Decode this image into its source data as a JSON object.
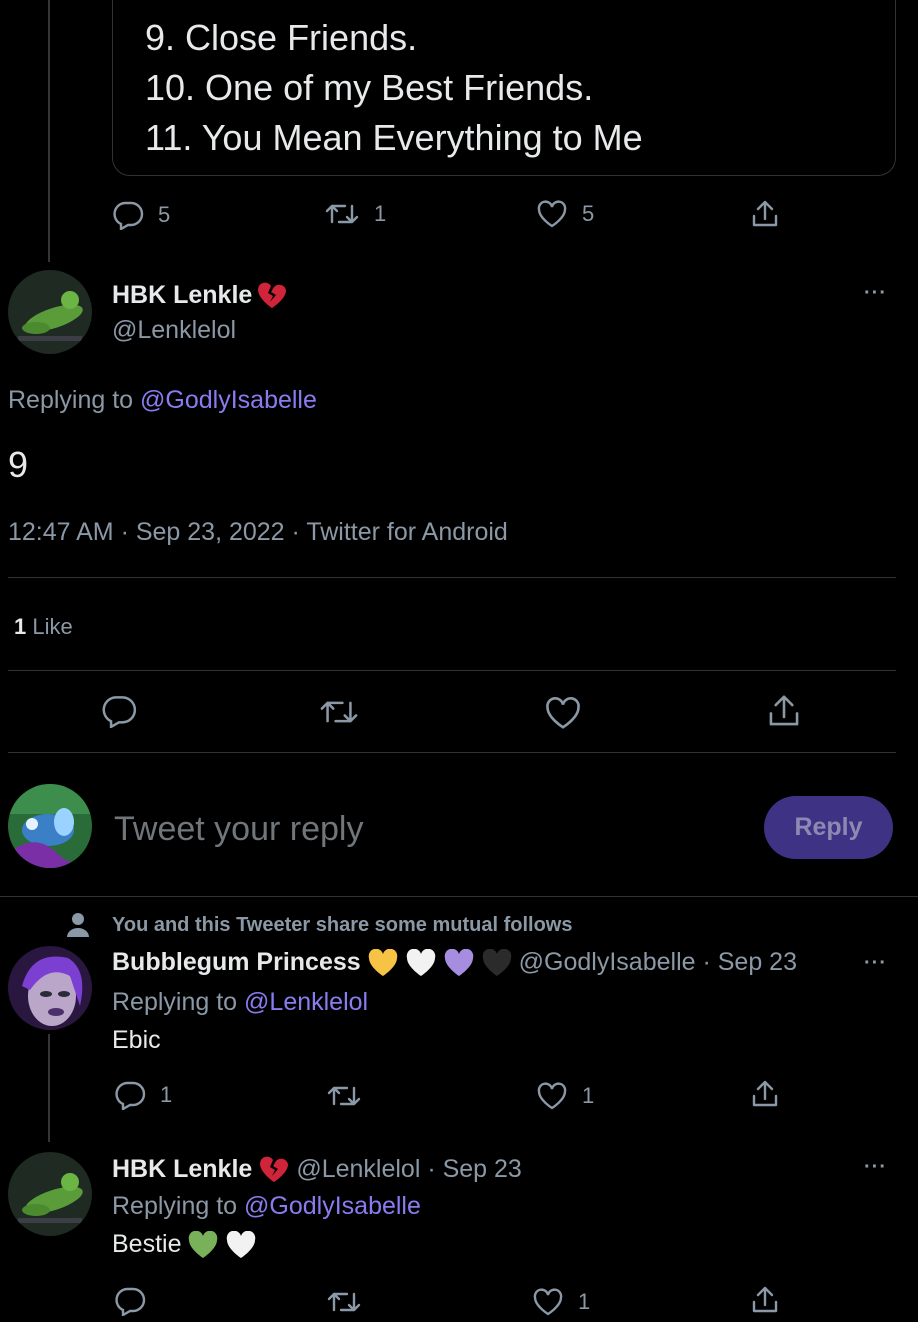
{
  "quoted_card": {
    "lines": [
      "9. Close Friends.",
      "10. One of my Best Friends.",
      "11. You Mean Everything to Me"
    ]
  },
  "parent_actions": {
    "replies": "5",
    "retweets": "1",
    "likes": "5"
  },
  "main_tweet": {
    "display_name": "HBK Lenkle",
    "handle": "@Lenklelol",
    "replying_prefix": "Replying to",
    "replying_to": "@GodlyIsabelle",
    "text": "9",
    "timestamp": "12:47 AM · Sep 23, 2022 · Twitter for Android",
    "likes_count": "1",
    "likes_label": "Like"
  },
  "reply_box": {
    "placeholder": "Tweet your reply",
    "button_label": "Reply"
  },
  "replies": [
    {
      "context": "You and this Tweeter share some mutual follows",
      "display_name": "Bubblegum Princess",
      "meta": "@GodlyIsabelle · Sep 23",
      "replying_prefix": "Replying to",
      "replying_to": "@Lenklelol",
      "text": "Ebic",
      "replies": "1",
      "likes": "1"
    },
    {
      "display_name": "HBK Lenkle",
      "meta": "@Lenklelol · Sep 23",
      "replying_prefix": "Replying to",
      "replying_to": "@GodlyIsabelle",
      "text": "Bestie",
      "likes": "1"
    }
  ],
  "colors": {
    "background": "#000000",
    "accent": "#8a7cf0",
    "reply_button": "#3d3283",
    "muted": "#8b98a5",
    "divider": "#2f3336"
  },
  "icons": [
    "reply-icon",
    "retweet-icon",
    "like-icon",
    "share-icon",
    "broken-heart-icon",
    "more-icon",
    "person-icon"
  ]
}
